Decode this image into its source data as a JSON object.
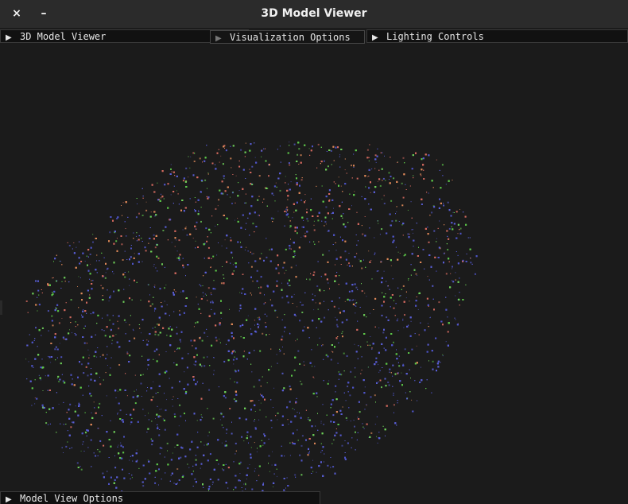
{
  "window": {
    "title": "3D Model Viewer",
    "close_icon": "×",
    "minimize_icon": "–"
  },
  "panels": {
    "model_viewer": {
      "label": "3D Model Viewer",
      "arrow": "▶"
    },
    "visualization": {
      "label": "Visualization Options",
      "arrow": "▶"
    },
    "lighting": {
      "label": "Lighting Controls",
      "arrow": "▶"
    },
    "model_view_options": {
      "label": "Model View Options",
      "arrow": "▶"
    }
  },
  "colors": {
    "background": "#1b1b1b",
    "titlebar": "#2b2b2b",
    "point_red": "#d46a5f",
    "point_green": "#6fd05a",
    "point_blue": "#5a5fd6"
  }
}
